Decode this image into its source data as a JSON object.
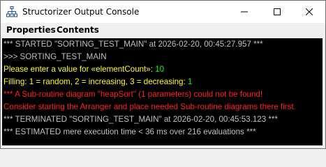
{
  "window": {
    "title": "Structorizer Output Console",
    "icon": "structorizer-app-icon"
  },
  "window_controls": {
    "minimize_icon": "minimize-icon",
    "maximize_icon": "maximize-icon",
    "close_icon": "close-icon"
  },
  "menu": {
    "properties": "Properties",
    "contents": "Contents"
  },
  "colors": {
    "console_background": "#000000",
    "info_text": "#c0c0c0",
    "prompt_text": "#ffff00",
    "input_value": "#00ff00",
    "error_text": "#ff2020"
  },
  "console": {
    "lines": [
      {
        "text": "*** STARTED \"SORTING_TEST_MAIN\" at 2026-02-20, 00:45:27.957 ***"
      },
      {
        "text": ">>> SORTING_TEST_MAIN"
      },
      {
        "prompt": "Please enter a value for «elementCount»: ",
        "value": "10"
      },
      {
        "prompt": "Filling: 1 = random, 2 = increasing, 3 = decreasing: ",
        "value": "1"
      },
      {
        "text": "*** A Sub-routine diagram \"heapSort\" (1 parameters) could not be found!"
      },
      {
        "text": "Consider starting the Arranger and place needed Sub-routine diagrams there first."
      },
      {
        "text": "*** TERMINATED \"SORTING_TEST_MAIN\" at 2026-02-20, 00:45:53.123 ***"
      },
      {
        "text": "*** ESTIMATED mere execution time < 36 ms over 216 evaluations ***"
      }
    ]
  }
}
